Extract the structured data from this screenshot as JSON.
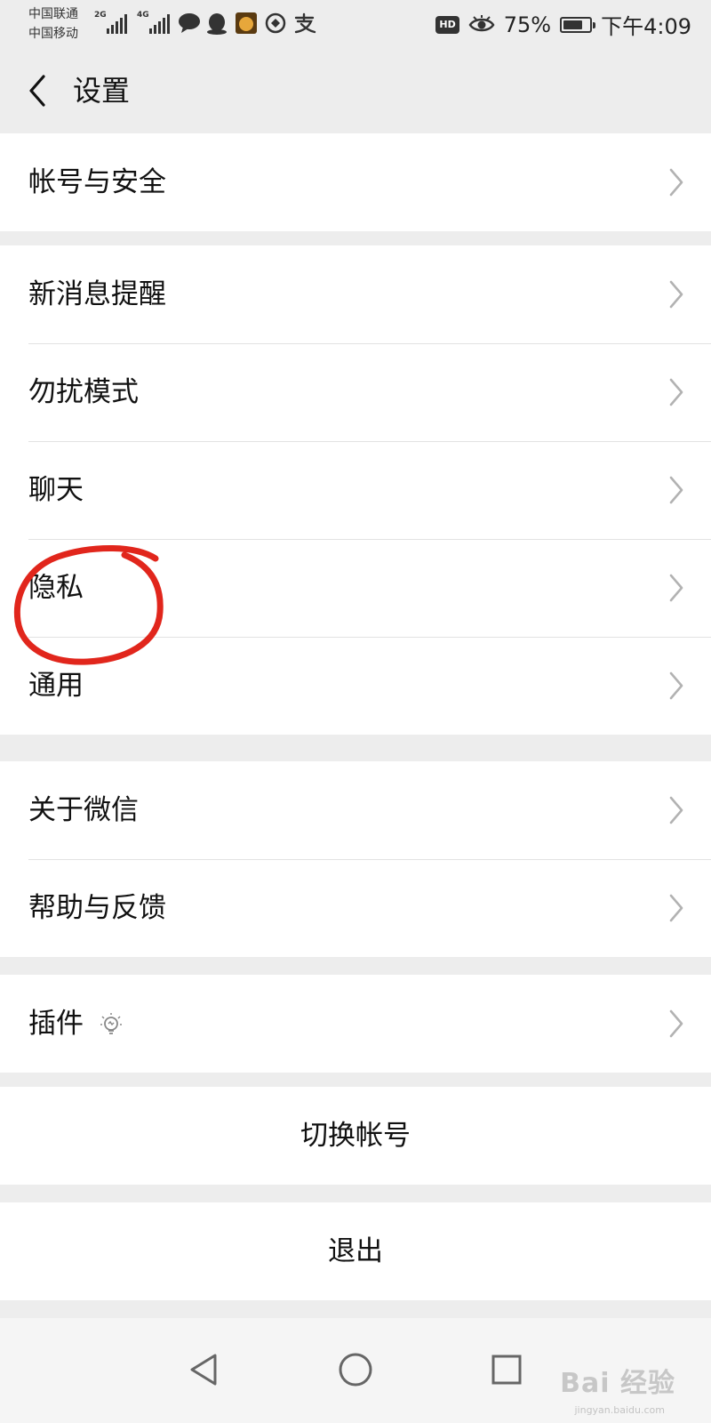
{
  "status_bar": {
    "carrier_1": "中国联通",
    "carrier_2": "中国移动",
    "net_1": "2G",
    "net_2": "4G",
    "hd": "HD",
    "battery_percent": "75%",
    "battery_level": 0.75,
    "time": "下午4:09",
    "icons": [
      "signal-icon",
      "chat-bubble-icon",
      "qq-icon",
      "app-icon",
      "app-icon",
      "alipay-icon",
      "eye-icon",
      "battery-icon"
    ]
  },
  "nav": {
    "title": "设置",
    "back_icon": "chevron-left-icon"
  },
  "groups": [
    {
      "items": [
        {
          "label": "帐号与安全"
        }
      ]
    },
    {
      "items": [
        {
          "label": "新消息提醒"
        },
        {
          "label": "勿扰模式"
        },
        {
          "label": "聊天"
        },
        {
          "label": "隐私"
        },
        {
          "label": "通用"
        }
      ]
    },
    {
      "items": [
        {
          "label": "关于微信"
        },
        {
          "label": "帮助与反馈"
        }
      ]
    },
    {
      "items": [
        {
          "label": "插件",
          "icon": "lightbulb-icon"
        }
      ]
    }
  ],
  "actions": {
    "switch_account": "切换帐号",
    "logout": "退出"
  },
  "annotation": {
    "color": "#e1261c",
    "highlights": "隐私"
  },
  "watermark": {
    "brand": "Bai 经验",
    "url": "jingyan.baidu.com"
  },
  "colors": {
    "background": "#ededed",
    "card": "#ffffff",
    "divider": "#e2e2e2",
    "chevron": "#b2b2b2"
  }
}
